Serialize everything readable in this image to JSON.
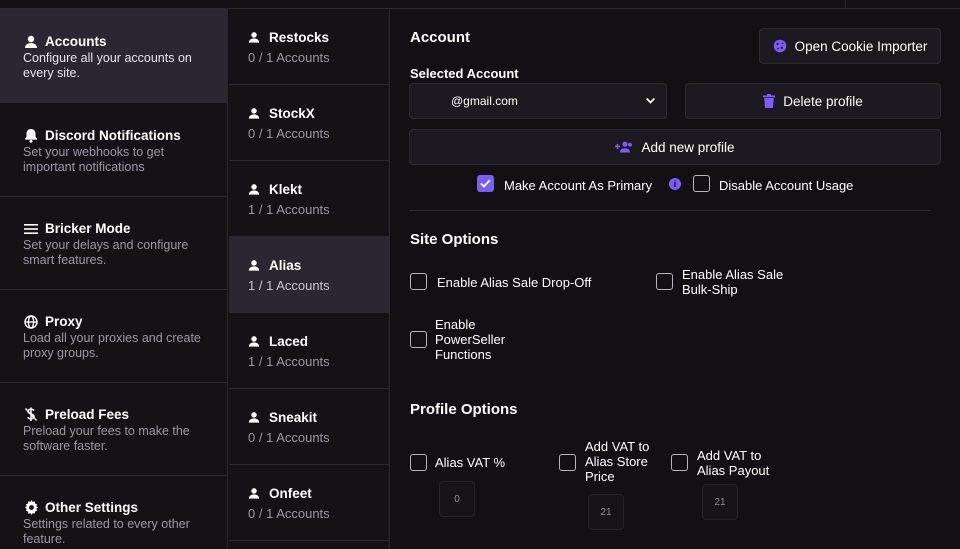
{
  "nav": {
    "items": [
      {
        "icon": "user-icon",
        "title": "Accounts",
        "desc": "Configure all your accounts on every site."
      },
      {
        "icon": "bell-icon",
        "title": "Discord Notifications",
        "desc": "Set your webhooks to get important notifications"
      },
      {
        "icon": "menu-icon",
        "title": "Bricker Mode",
        "desc": "Set your delays and configure smart features."
      },
      {
        "icon": "globe-icon",
        "title": "Proxy",
        "desc": "Load all your proxies and create proxy groups."
      },
      {
        "icon": "dollar-off-icon",
        "title": "Preload Fees",
        "desc": "Preload your fees to make the software faster."
      },
      {
        "icon": "gear-icon",
        "title": "Other Settings",
        "desc": "Settings related to every other feature."
      }
    ]
  },
  "sites": {
    "items": [
      {
        "name": "Restocks",
        "count": "0 / 1 Accounts"
      },
      {
        "name": "StockX",
        "count": "0 / 1 Accounts"
      },
      {
        "name": "Klekt",
        "count": "1 / 1 Accounts"
      },
      {
        "name": "Alias",
        "count": "1 / 1 Accounts"
      },
      {
        "name": "Laced",
        "count": "1 / 1 Accounts"
      },
      {
        "name": "Sneakit",
        "count": "0 / 1 Accounts"
      },
      {
        "name": "Onfeet",
        "count": "0 / 1 Accounts"
      }
    ]
  },
  "account": {
    "heading": "Account",
    "cookie_button": "Open Cookie Importer",
    "selected_label": "Selected Account",
    "selected_value": "@gmail.com",
    "delete_button": "Delete profile",
    "add_button": "Add new profile",
    "primary_label": "Make Account As Primary",
    "primary_checked": true,
    "disable_label": "Disable Account Usage",
    "disable_checked": false
  },
  "site_options": {
    "heading": "Site Options",
    "drop_off": "Enable Alias Sale Drop-Off",
    "bulk_ship_1": "Enable Alias Sale",
    "bulk_ship_2": "Bulk-Ship",
    "power_1": "Enable",
    "power_2": "PowerSeller",
    "power_3": "Functions"
  },
  "profile_options": {
    "heading": "Profile Options",
    "vat_label": "Alias VAT %",
    "vat_value": "0",
    "store_1": "Add VAT to",
    "store_2": "Alias Store",
    "store_3": "Price",
    "store_value": "21",
    "payout_1": "Add VAT to",
    "payout_2": "Alias Payout",
    "payout_value": "21"
  },
  "colors": {
    "accent": "#7c5cff",
    "background": "#121015",
    "panel": "#1c1a20",
    "active": "#2a2730"
  }
}
